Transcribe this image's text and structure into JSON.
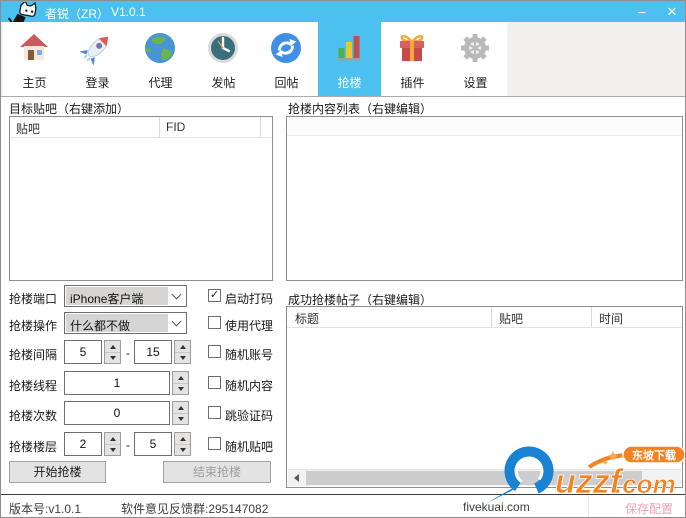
{
  "window": {
    "title": "者锐（ZR）",
    "version": "V1.0.1",
    "minimize_glyph": "–",
    "close_glyph": "✕"
  },
  "toolbar": {
    "selected": "抢楼",
    "tabs": [
      {
        "label": "主页",
        "icon": "home-icon"
      },
      {
        "label": "登录",
        "icon": "rocket-icon"
      },
      {
        "label": "代理",
        "icon": "globe-icon"
      },
      {
        "label": "发帖",
        "icon": "clock-icon"
      },
      {
        "label": "回帖",
        "icon": "refresh-icon"
      },
      {
        "label": "抢楼",
        "icon": "barchart-icon"
      },
      {
        "label": "插件",
        "icon": "gift-icon"
      },
      {
        "label": "设置",
        "icon": "gear-icon"
      }
    ]
  },
  "target_panel": {
    "label": "目标贴吧（右键添加）",
    "columns": [
      "贴吧",
      "FID"
    ],
    "rows": []
  },
  "content_panel": {
    "label": "抢楼内容列表（右键编辑）",
    "rows": []
  },
  "success_panel": {
    "label": "成功抢楼帖子（右键编辑）",
    "columns": [
      "标题",
      "贴吧",
      "时间"
    ],
    "rows": []
  },
  "form": {
    "port": {
      "label": "抢楼端口",
      "value": "iPhone客户端"
    },
    "action": {
      "label": "抢楼操作",
      "value": "什么都不做"
    },
    "interval": {
      "label": "抢楼间隔",
      "from": "5",
      "to": "15"
    },
    "threads": {
      "label": "抢楼线程",
      "value": "1"
    },
    "times": {
      "label": "抢楼次数",
      "value": "0"
    },
    "floors": {
      "label": "抢楼楼层",
      "from": "2",
      "to": "5"
    },
    "range_separator": "-",
    "checkboxes": [
      {
        "label": "启动打码",
        "checked": true,
        "mark": "✓"
      },
      {
        "label": "使用代理",
        "checked": false,
        "mark": ""
      },
      {
        "label": "随机账号",
        "checked": false,
        "mark": ""
      },
      {
        "label": "随机内容",
        "checked": false,
        "mark": ""
      },
      {
        "label": "跳验证码",
        "checked": false,
        "mark": ""
      },
      {
        "label": "随机贴吧",
        "checked": false,
        "mark": ""
      }
    ]
  },
  "buttons": {
    "start": "开始抢楼",
    "stop": "结束抢楼"
  },
  "statusbar": {
    "version": "版本号:v1.0.1",
    "feedback": "软件意见反馈群:295147082",
    "site": "fivekuai.com",
    "save": "保存配置"
  },
  "watermark": {
    "brand": "uzzf",
    "tld": ".com",
    "badge": "东坡下载"
  },
  "colors": {
    "titlebar": "#4cc0ee",
    "accent_orange": "#f58220",
    "accent_blue": "#1a82d2",
    "save_pink": "#f29fb6"
  }
}
